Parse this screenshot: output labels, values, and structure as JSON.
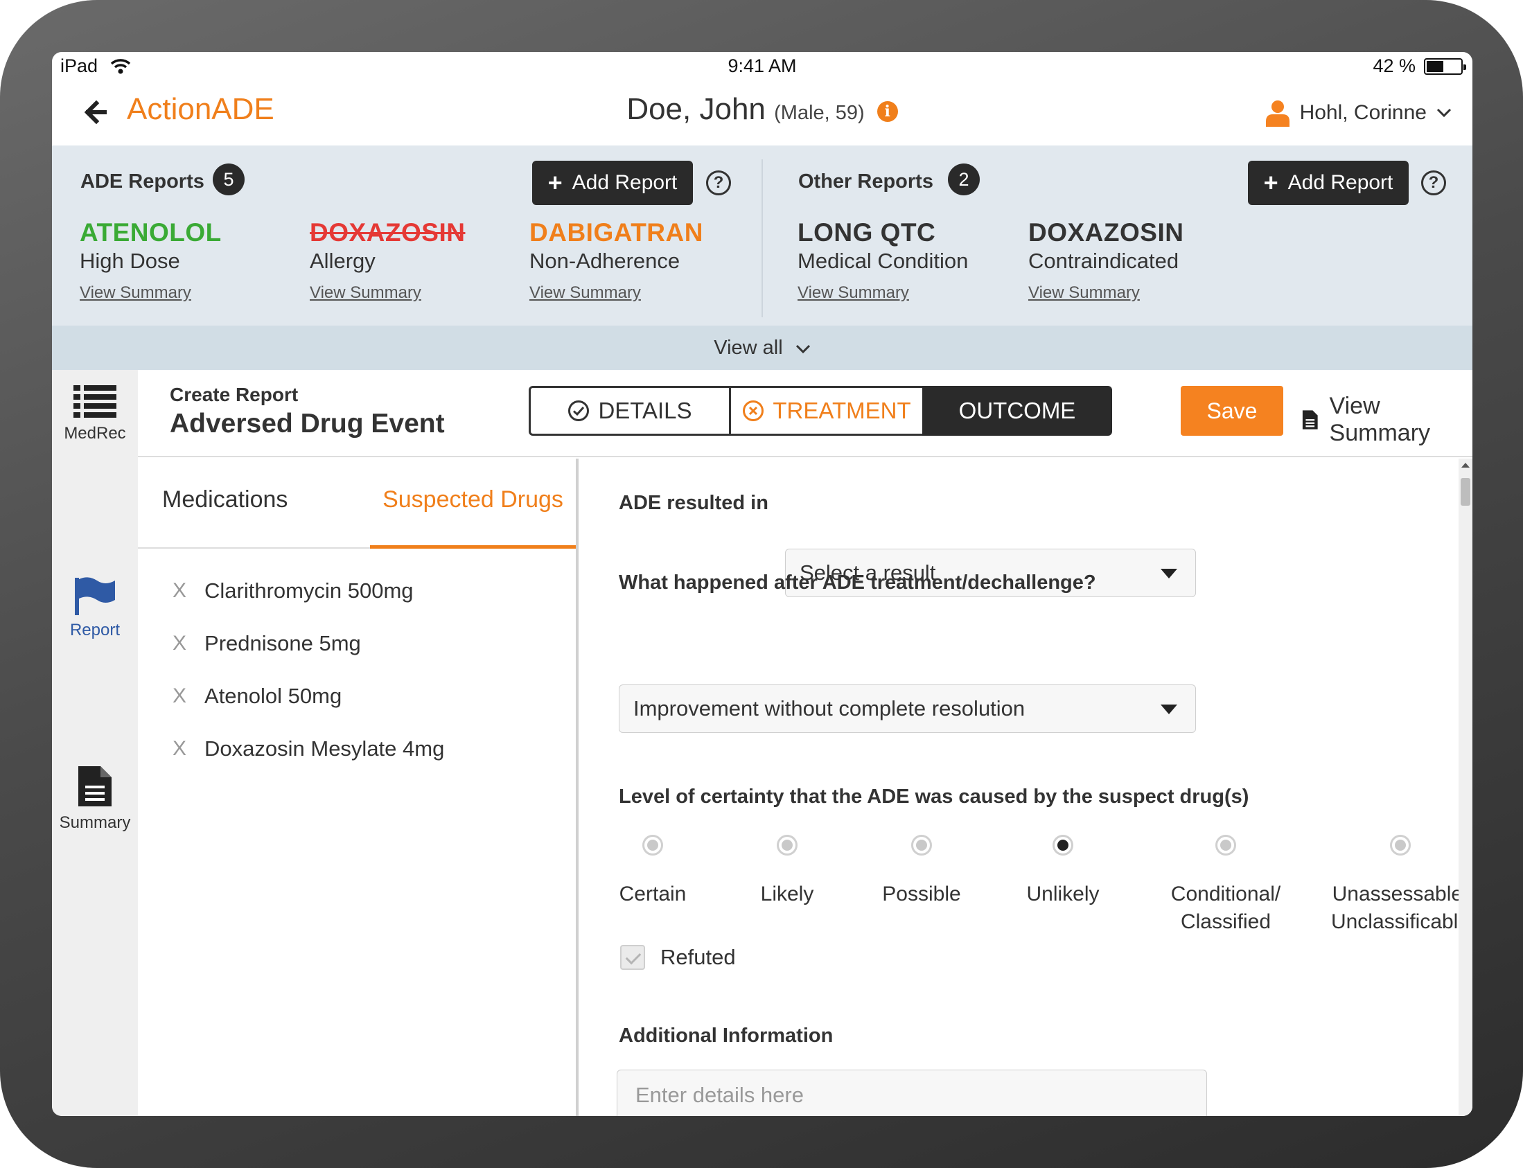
{
  "status": {
    "device": "iPad",
    "time": "9:41 AM",
    "battery": "42 %"
  },
  "nav": {
    "app_title": "ActionADE",
    "patient_name": "Doe, John",
    "patient_info": "(Male, 59)",
    "user": "Hohl, Corinne"
  },
  "ade_reports": {
    "title": "ADE Reports",
    "count": "5",
    "add_label": "Add Report",
    "help": "?",
    "items": [
      {
        "drug": "ATENOLOL",
        "type": "High Dose",
        "link": "View Summary"
      },
      {
        "drug": "DOXAZOSIN",
        "type": "Allergy",
        "link": "View Summary"
      },
      {
        "drug": "DABIGATRAN",
        "type": "Non-Adherence",
        "link": "View Summary"
      }
    ]
  },
  "other_reports": {
    "title": "Other Reports",
    "count": "2",
    "add_label": "Add Report",
    "help": "?",
    "items": [
      {
        "drug": "LONG QTC",
        "type": "Medical Condition",
        "link": "View Summary"
      },
      {
        "drug": "DOXAZOSIN",
        "type": "Contraindicated",
        "link": "View Summary"
      }
    ]
  },
  "view_all": "View all",
  "sidebar": {
    "medrec": "MedRec",
    "report": "Report",
    "summary": "Summary"
  },
  "create": {
    "small_title": "Create Report",
    "big_title": "Adversed Drug Event",
    "steps": {
      "details": "DETAILS",
      "treatment": "TREATMENT",
      "outcome": "OUTCOME"
    },
    "save": "Save",
    "view_summary": "View Summary"
  },
  "drug_panel": {
    "tabs": {
      "medications": "Medications",
      "suspected": "Suspected Drugs"
    },
    "remove_glyph": "X",
    "drugs": [
      "Clarithromycin 500mg",
      "Prednisone 5mg",
      "Atenolol 50mg",
      "Doxazosin Mesylate 4mg"
    ]
  },
  "form": {
    "ade_result_label": "ADE resulted in",
    "ade_result_value": "Select a result",
    "after_label": "What happened after ADE treatment/dechallenge?",
    "after_value": "Improvement without complete resolution",
    "certainty_label": "Level of certainty that the ADE was caused by the suspect drug(s)",
    "certainty_options": [
      {
        "line1": "Certain",
        "line2": ""
      },
      {
        "line1": "Likely",
        "line2": ""
      },
      {
        "line1": "Possible",
        "line2": ""
      },
      {
        "line1": "Unlikely",
        "line2": ""
      },
      {
        "line1": "Conditional/",
        "line2": "Classified"
      },
      {
        "line1": "Unassessable/",
        "line2": "Unclassificable"
      }
    ],
    "certainty_selected": "Unlikely",
    "refuted_label": "Refuted",
    "additional_label": "Additional Information",
    "additional_placeholder": "Enter details here"
  },
  "colors": {
    "accent": "#f07f1b",
    "dark": "#2a2a2a",
    "panel": "#e1e8ee",
    "green": "#3aaa35",
    "red": "#e53935"
  }
}
